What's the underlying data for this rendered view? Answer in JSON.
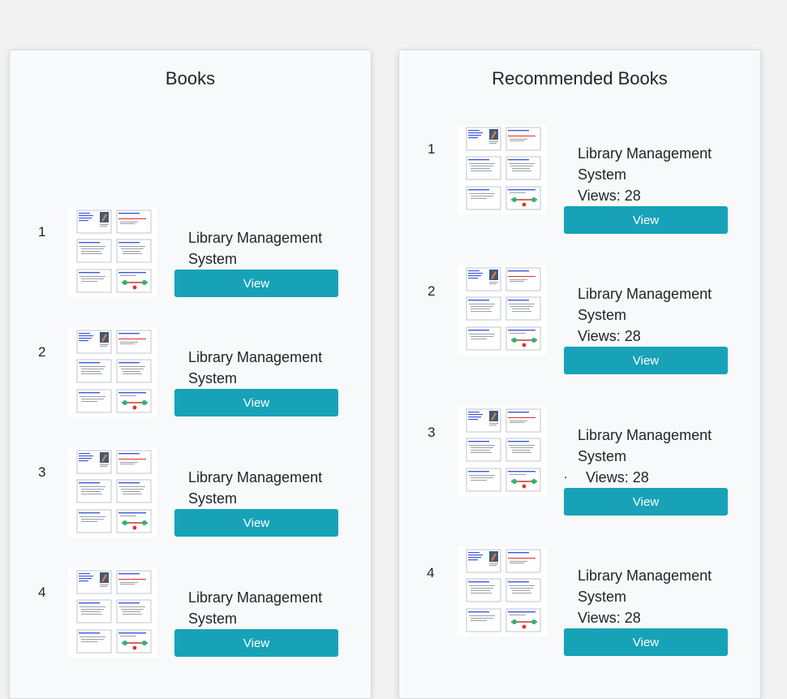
{
  "books_panel": {
    "title": "Books",
    "items": [
      {
        "index": "1",
        "title": "Library Management System",
        "button_label": "View"
      },
      {
        "index": "2",
        "title": "Library Management System",
        "button_label": "View"
      },
      {
        "index": "3",
        "title": "Library Management System",
        "button_label": "View"
      },
      {
        "index": "4",
        "title": "Library Management System",
        "button_label": "View"
      }
    ]
  },
  "recommended_panel": {
    "title": "Recommended Books",
    "items": [
      {
        "index": "1",
        "title": "Library Management System",
        "views": "Views: 28",
        "button_label": "View"
      },
      {
        "index": "2",
        "title": "Library Management System",
        "views": "Views: 28",
        "button_label": "View"
      },
      {
        "index": "3",
        "title": "Library Management System",
        "views": "Views: 28",
        "button_label": "View",
        "prefix": "."
      },
      {
        "index": "4",
        "title": "Library Management System",
        "views": "Views: 28",
        "button_label": "View"
      }
    ]
  },
  "colors": {
    "button": "#17a2b8",
    "panel_background": "#f8f9fa",
    "page_background": "#f2f2f2"
  },
  "icons": {
    "book_thumbnail": "slide-deck-thumbnail"
  }
}
